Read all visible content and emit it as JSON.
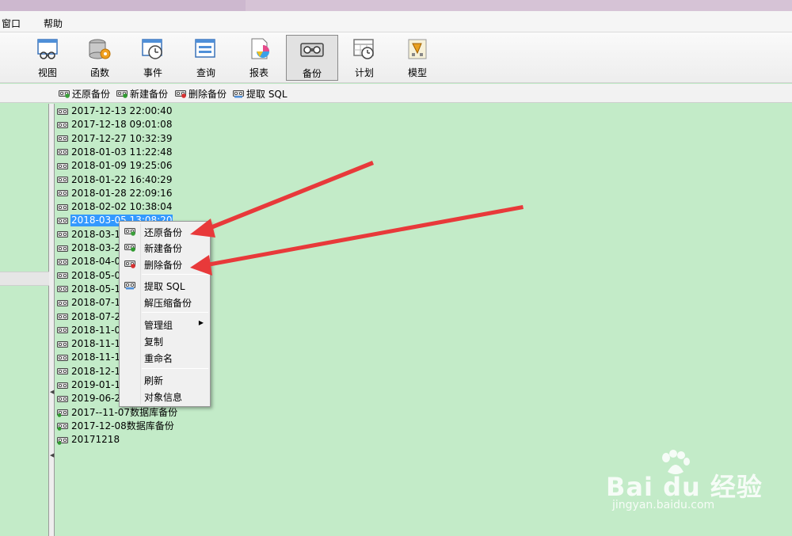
{
  "menubar": {
    "items": [
      "窗口",
      "帮助"
    ]
  },
  "toolbar": {
    "buttons": [
      {
        "label": "视图",
        "icon": "view-icon"
      },
      {
        "label": "函数",
        "icon": "function-icon"
      },
      {
        "label": "事件",
        "icon": "event-icon"
      },
      {
        "label": "查询",
        "icon": "query-icon"
      },
      {
        "label": "报表",
        "icon": "report-icon"
      },
      {
        "label": "备份",
        "icon": "backup-icon",
        "active": true
      },
      {
        "label": "计划",
        "icon": "schedule-icon"
      },
      {
        "label": "模型",
        "icon": "model-icon"
      }
    ]
  },
  "subtoolbar": {
    "restore": "还原备份",
    "new": "新建备份",
    "delete": "删除备份",
    "extract": "提取 SQL"
  },
  "files": [
    "2017-12-13 22:00:40",
    "2017-12-18 09:01:08",
    "2017-12-27 10:32:39",
    "2018-01-03 11:22:48",
    "2018-01-09 19:25:06",
    "2018-01-22 16:40:29",
    "2018-01-28 22:09:16",
    "2018-02-02 10:38:04",
    "2018-03-05 13:08:20",
    "2018-03-18",
    "2018-03-25",
    "2018-04-08",
    "2018-05-01",
    "2018-05-13",
    "2018-07-17",
    "2018-07-24",
    "2018-11-04",
    "2018-11-10",
    "2018-11-17",
    "2018-12-15",
    "2019-01-19",
    "2019-06-24",
    "2017--11-07数据库备份",
    "2017-12-08数据库备份",
    "20171218"
  ],
  "selected_file_index": 8,
  "context_menu": {
    "restore": "还原备份",
    "new": "新建备份",
    "delete": "删除备份",
    "extract": "提取 SQL",
    "decompress": "解压缩备份",
    "manage_group": "管理组",
    "copy": "复制",
    "rename": "重命名",
    "refresh": "刷新",
    "object_info": "对象信息"
  },
  "watermark": {
    "logo": "Bai du 经验",
    "url": "jingyan.baidu.com"
  },
  "colors": {
    "background": "#c3ebc8",
    "selection": "#3399ff",
    "arrow": "#e8393a"
  }
}
